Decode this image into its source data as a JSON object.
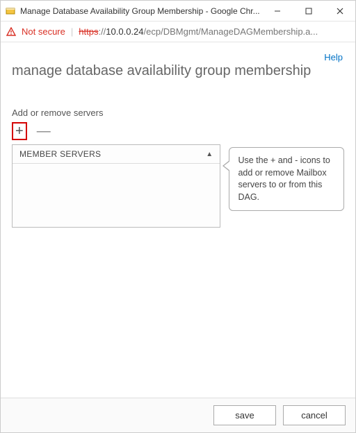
{
  "window": {
    "title": "Manage Database Availability Group Membership - Google Chr..."
  },
  "addressbar": {
    "not_secure": "Not secure",
    "scheme": "https",
    "sep": "://",
    "host_path": "10.0.0.24",
    "rest": "/ecp/DBMgmt/ManageDAGMembership.a..."
  },
  "page": {
    "help": "Help",
    "heading": "manage database availability group membership",
    "section_label": "Add or remove servers",
    "grid_header": "MEMBER SERVERS",
    "callout": "Use the + and - icons to add or remove Mailbox servers to or from this DAG."
  },
  "buttons": {
    "save": "save",
    "cancel": "cancel"
  }
}
